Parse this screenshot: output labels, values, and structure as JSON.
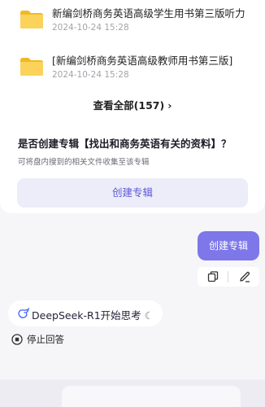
{
  "files": [
    {
      "name": "新编剑桥商务英语高级学生用书第三版听力",
      "time": "2024-10-24 15:28",
      "icon": "folder-icon"
    },
    {
      "name": "[新编剑桥商务英语高级教师用书第三版]",
      "time": "2024-10-24 15:28",
      "icon": "folder-icon"
    }
  ],
  "view_all": {
    "label": "查看全部(157)",
    "icon": "chevron-right-icon"
  },
  "prompt": {
    "question": "是否创建专辑【找出和商务英语有关的资料】？",
    "subtitle": "可将盘内搜到的相关文件收集至该专辑",
    "button": "创建专辑"
  },
  "user_message": {
    "text": "创建专辑",
    "actions": [
      "copy-icon",
      "edit-icon"
    ]
  },
  "assistant": {
    "status": "DeepSeek-R1开始思考",
    "icons": [
      "deepseek-logo-icon",
      "loading-moon-icon"
    ],
    "stop_label": "停止回答",
    "stop_icon": "stop-icon"
  },
  "colors": {
    "accent": "#7d77ea",
    "button_bg": "#ededf9",
    "button_text": "#5a57d9",
    "folder": "#f7c948"
  }
}
